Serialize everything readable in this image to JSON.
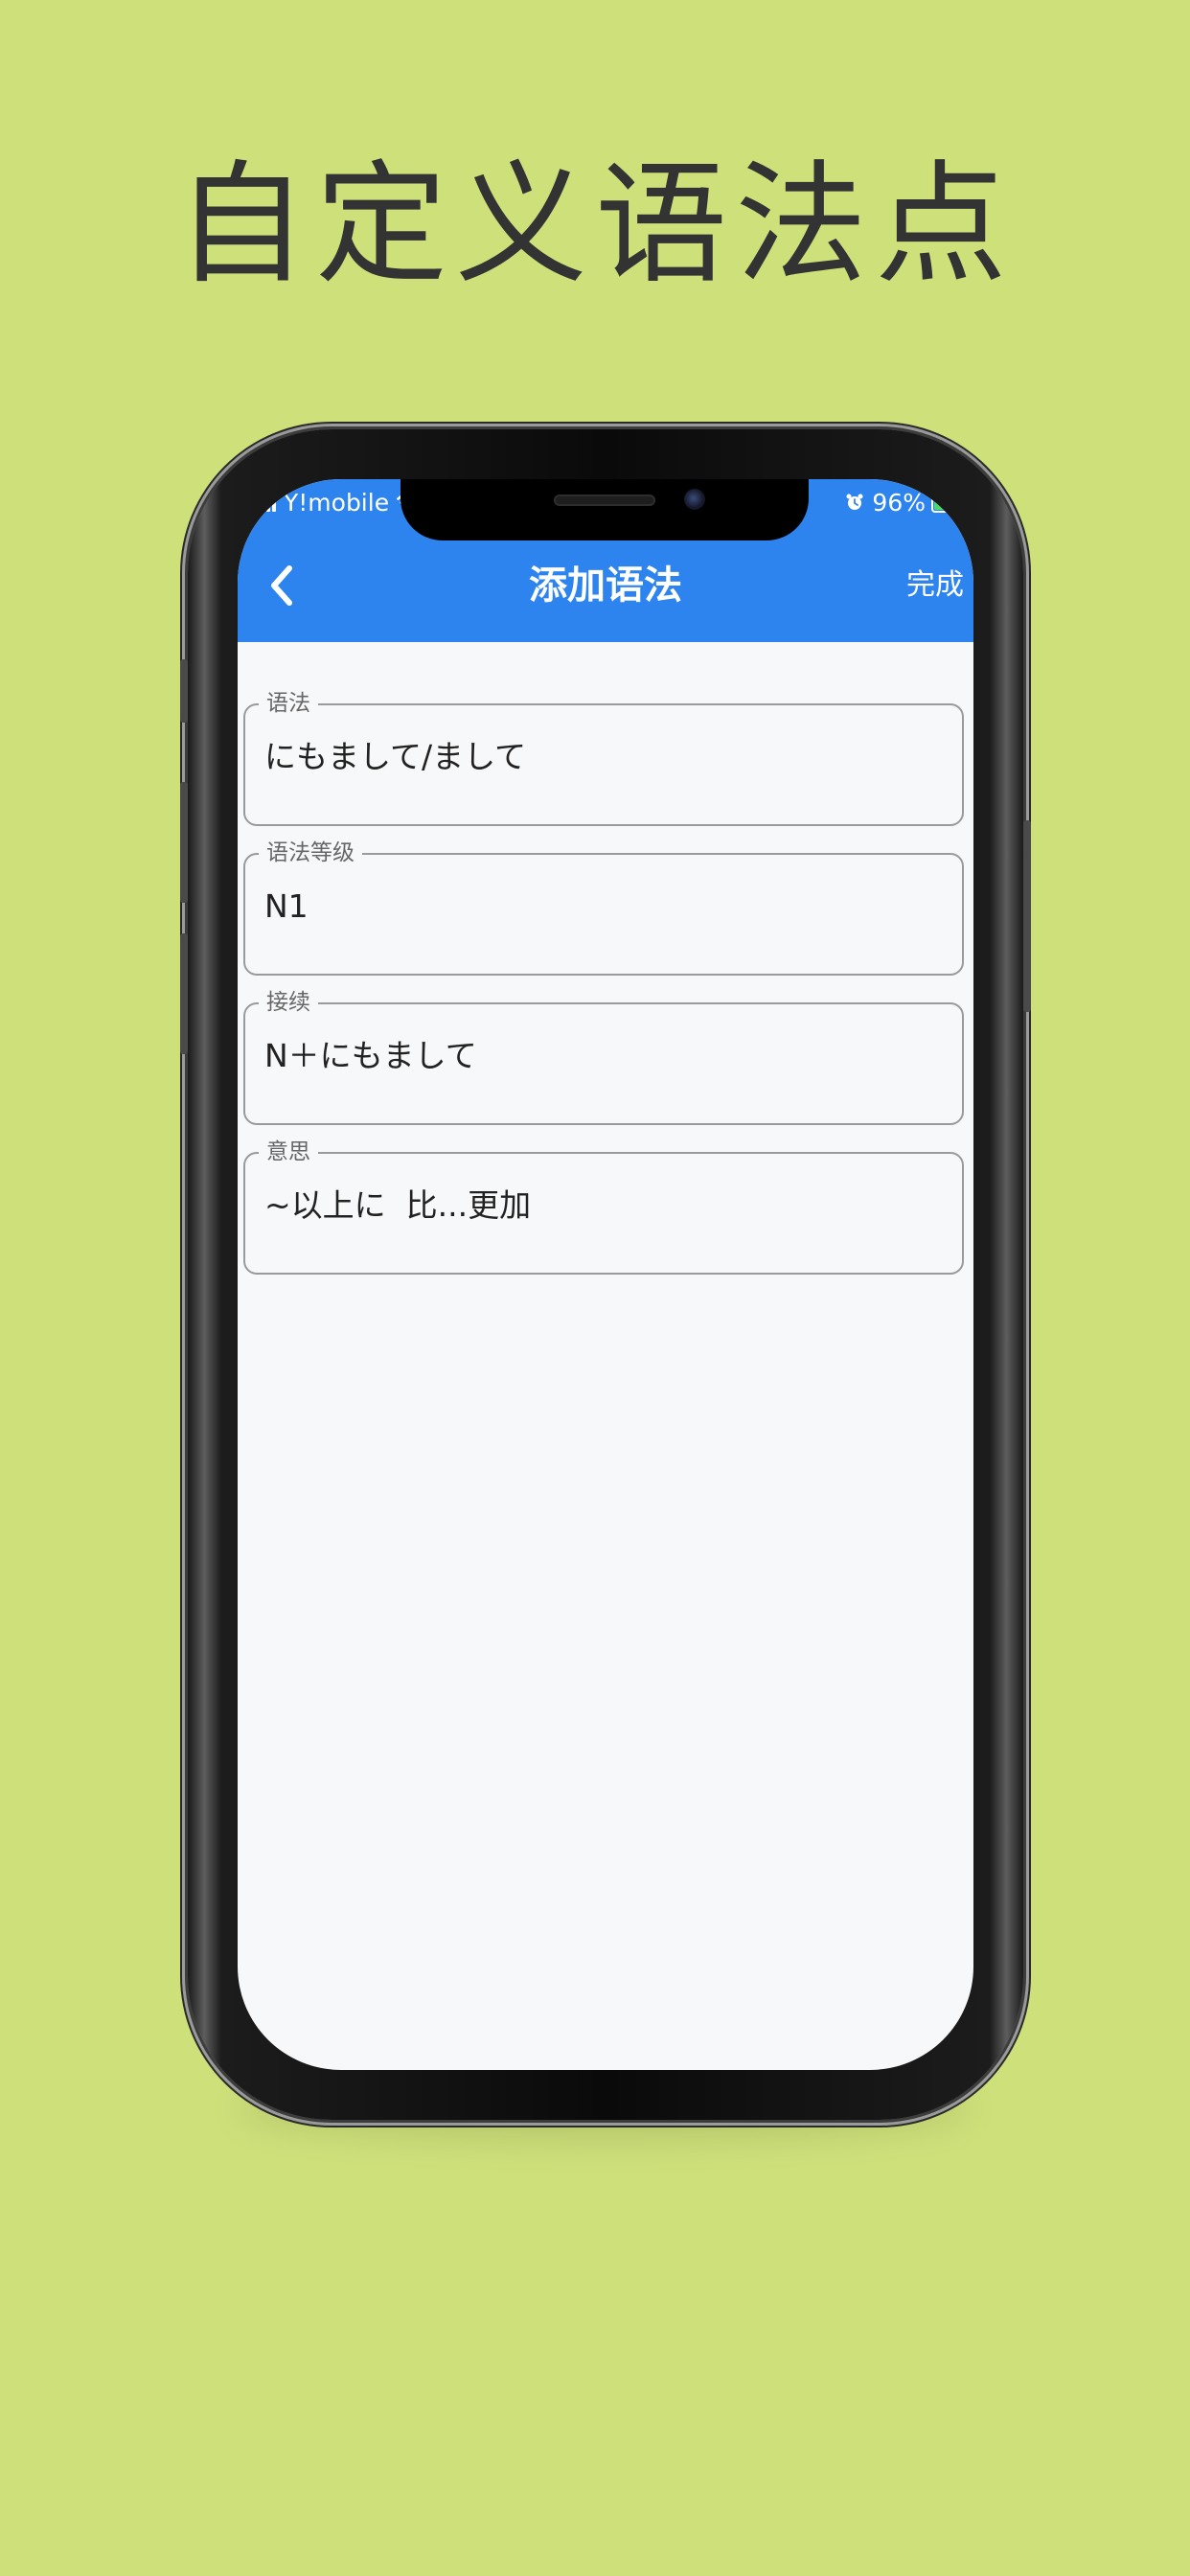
{
  "headline": "自定义语法点",
  "colors": {
    "background": "#cde07a",
    "app_bar": "#2e84ee",
    "screen_background": "#f7f8fa",
    "battery_green": "#4cd964"
  },
  "status_bar": {
    "carrier": "Y!mobile",
    "battery_percent": "96%",
    "battery_level": 0.96,
    "icons": [
      "signal-icon",
      "wifi-icon",
      "alarm-icon",
      "battery-icon"
    ]
  },
  "nav": {
    "back_icon": "chevron-left-icon",
    "title": "添加语法",
    "done_label": "完成"
  },
  "fields": [
    {
      "label": "语法",
      "value": "にもまして/まして"
    },
    {
      "label": "语法等级",
      "value": "N1"
    },
    {
      "label": "接续",
      "value": "N＋にもまして"
    },
    {
      "label": "意思",
      "value": "~以上に  比...更加"
    }
  ]
}
